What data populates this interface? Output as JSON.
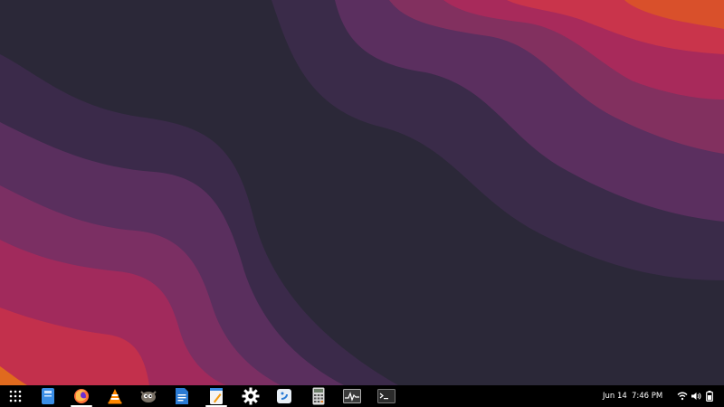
{
  "wallpaper": {
    "colors": [
      "#2b2838",
      "#3b2a4a",
      "#5a2f5e",
      "#7b2f63",
      "#a12a5c",
      "#c3304c",
      "#d6442e",
      "#e06a1e"
    ]
  },
  "taskbar": {
    "launchers": [
      {
        "name": "app-grid-icon",
        "active": false
      },
      {
        "name": "file-manager-icon",
        "active": false
      },
      {
        "name": "firefox-icon",
        "active": true
      },
      {
        "name": "vlc-icon",
        "active": false
      },
      {
        "name": "gimp-icon",
        "active": false
      },
      {
        "name": "libreoffice-writer-icon",
        "active": false
      },
      {
        "name": "text-editor-icon",
        "active": true
      },
      {
        "name": "settings-gear-icon",
        "active": false
      },
      {
        "name": "software-store-icon",
        "active": false
      },
      {
        "name": "calculator-icon",
        "active": false
      },
      {
        "name": "system-monitor-icon",
        "active": false
      },
      {
        "name": "terminal-icon",
        "active": false
      }
    ],
    "date": "Jun 14",
    "time": "7:46 PM",
    "tray_icons": [
      "wifi-icon",
      "volume-icon",
      "battery-icon"
    ]
  }
}
